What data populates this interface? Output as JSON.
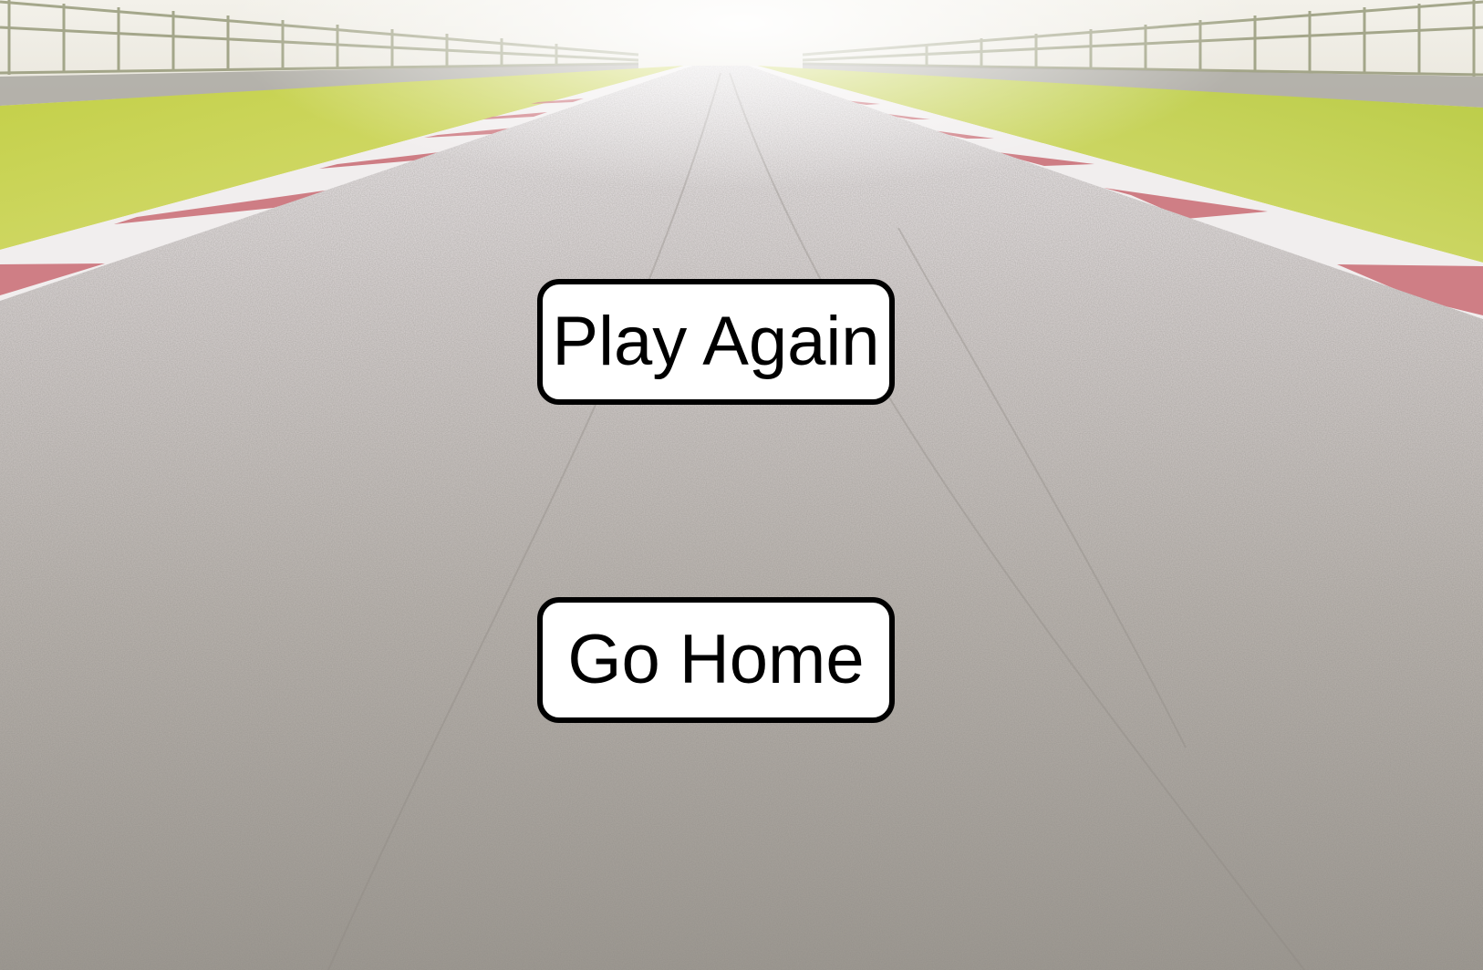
{
  "menu": {
    "play_again_label": "Play Again",
    "go_home_label": "Go Home"
  },
  "colors": {
    "button_background": "#ffffff",
    "button_border": "#000000",
    "grass": "#c9d45a",
    "asphalt": "#b7b2ad",
    "curb_red": "#c96a72"
  }
}
